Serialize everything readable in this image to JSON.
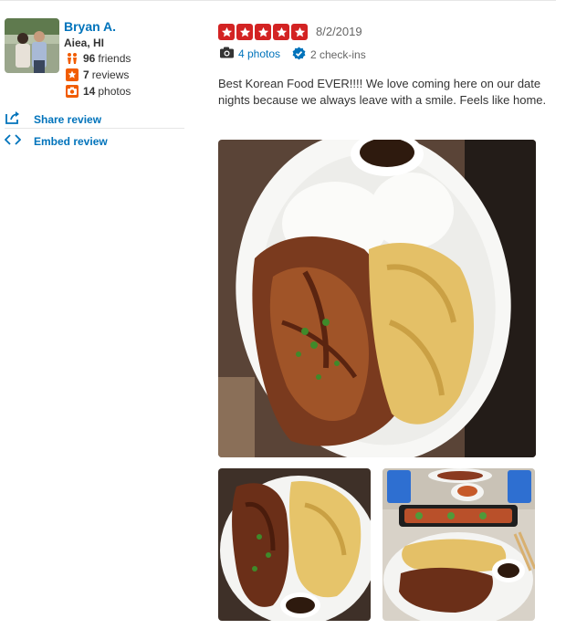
{
  "user": {
    "name": "Bryan A.",
    "location": "Aiea, HI",
    "friends_count": "96",
    "friends_label": "friends",
    "reviews_count": "7",
    "reviews_label": "reviews",
    "photos_count": "14",
    "photos_label": "photos"
  },
  "actions": {
    "share": "Share review",
    "embed": "Embed review"
  },
  "review": {
    "rating": 5,
    "date": "8/2/2019",
    "photos_link": "4 photos",
    "checkins": "2 check-ins",
    "text": "Best Korean Food EVER!!!! We love coming here on our date nights because we always leave with a smile. Feels like home."
  },
  "colors": {
    "link_blue": "#0073bb",
    "star_red": "#d32323",
    "friends_orange": "#f15c00",
    "check_blue": "#0073bb"
  },
  "icons": {
    "friends": "friends-icon",
    "reviews": "star-icon",
    "photos": "camera-icon",
    "share": "share-icon",
    "embed": "code-icon",
    "checkin": "check-badge-icon"
  }
}
